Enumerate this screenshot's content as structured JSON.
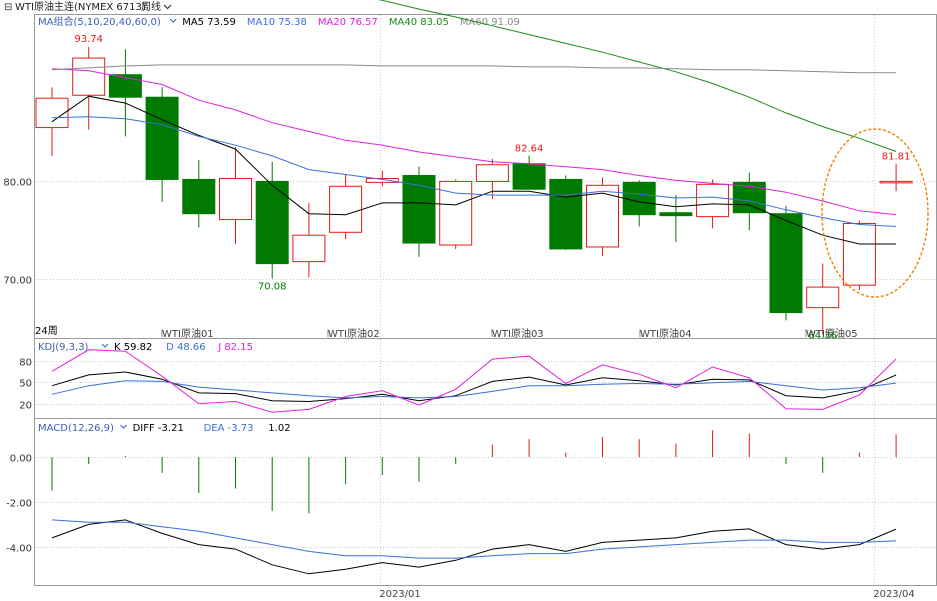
{
  "header": {
    "instrument": "WTI原油主连(NYMEX 6713)",
    "period": "周线",
    "dropdown_arrow": "chevron-down-icon"
  },
  "colors": {
    "up": "#e31a1a",
    "down": "#007a00",
    "ma5": "#000000",
    "ma10": "#3b6fd6",
    "ma20": "#e020e0",
    "ma40": "#1a8a1a",
    "ma60": "#8a8a8a",
    "k": "#000000",
    "d": "#3b6fd6",
    "j": "#e020e0",
    "highlight_ellipse": "#f08000"
  },
  "ma_legend": {
    "label": "MA组合(5,10,20,40,60,0)",
    "items": [
      {
        "name": "MA5",
        "value": "73.59"
      },
      {
        "name": "MA10",
        "value": "75.38"
      },
      {
        "name": "MA20",
        "value": "76.57"
      },
      {
        "name": "MA40",
        "value": "83.05"
      },
      {
        "name": "MA60",
        "value": "91.09"
      }
    ]
  },
  "kdj_legend": {
    "label": "KDJ(9,3,3)",
    "items": [
      {
        "name": "K",
        "value": "59.82"
      },
      {
        "name": "D",
        "value": "48.66"
      },
      {
        "name": "J",
        "value": "82.15"
      }
    ]
  },
  "macd_legend": {
    "label": "MACD(12,26,9)",
    "items": [
      {
        "name": "DIFF",
        "value": "-3.21"
      },
      {
        "name": "DEA",
        "value": "-3.73"
      },
      {
        "name": "",
        "value": "1.02"
      }
    ]
  },
  "price_annotations": {
    "high": "93.74",
    "low": "70.08",
    "recent_high": "82.64",
    "last": "81.81",
    "recent_low": "64.36"
  },
  "period_marker": "24周",
  "contract_labels": [
    "WTI原油01",
    "WTI原油02",
    "WTI原油03",
    "WTI原油04",
    "WTI原油05"
  ],
  "x_date_labels": [
    "2023/01",
    "2023/04"
  ],
  "chart_data": [
    {
      "type": "candlestick",
      "name": "price",
      "ylim": [
        64,
        97
      ],
      "yticks": [
        "80.00",
        "70.00"
      ],
      "ytick_values": [
        80,
        70
      ],
      "candles": [
        {
          "o": 85.5,
          "h": 89.6,
          "l": 82.6,
          "c": 88.5
        },
        {
          "o": 88.8,
          "h": 93.74,
          "l": 85.3,
          "c": 92.6
        },
        {
          "o": 90.9,
          "h": 93.5,
          "l": 84.6,
          "c": 88.6
        },
        {
          "o": 88.6,
          "h": 89.6,
          "l": 77.9,
          "c": 80.2
        },
        {
          "o": 80.2,
          "h": 82.2,
          "l": 75.3,
          "c": 76.7
        },
        {
          "o": 76.1,
          "h": 83.5,
          "l": 73.6,
          "c": 80.3
        },
        {
          "o": 80.0,
          "h": 82.0,
          "l": 70.08,
          "c": 71.6
        },
        {
          "o": 71.8,
          "h": 77.8,
          "l": 70.2,
          "c": 74.5
        },
        {
          "o": 74.8,
          "h": 80.7,
          "l": 74.1,
          "c": 79.5
        },
        {
          "o": 79.9,
          "h": 81.1,
          "l": 79.5,
          "c": 80.3
        },
        {
          "o": 80.6,
          "h": 81.5,
          "l": 72.3,
          "c": 73.7
        },
        {
          "o": 73.5,
          "h": 80.2,
          "l": 73.1,
          "c": 80.0
        },
        {
          "o": 80.0,
          "h": 82.3,
          "l": 78.2,
          "c": 81.7
        },
        {
          "o": 81.8,
          "h": 82.64,
          "l": 79.2,
          "c": 79.2
        },
        {
          "o": 80.2,
          "h": 80.6,
          "l": 73.0,
          "c": 73.1
        },
        {
          "o": 73.3,
          "h": 80.4,
          "l": 72.4,
          "c": 79.6
        },
        {
          "o": 79.9,
          "h": 80.1,
          "l": 75.4,
          "c": 76.6
        },
        {
          "o": 76.8,
          "h": 78.6,
          "l": 73.8,
          "c": 76.5
        },
        {
          "o": 76.4,
          "h": 80.2,
          "l": 75.2,
          "c": 79.7
        },
        {
          "o": 79.9,
          "h": 80.9,
          "l": 75.0,
          "c": 76.8
        },
        {
          "o": 76.7,
          "h": 77.5,
          "l": 65.8,
          "c": 66.6
        },
        {
          "o": 67.1,
          "h": 71.6,
          "l": 64.36,
          "c": 69.2
        },
        {
          "o": 69.4,
          "h": 76.0,
          "l": 68.9,
          "c": 75.7
        },
        {
          "o": 80.0,
          "h": 81.81,
          "l": 79.0,
          "c": 80.0
        }
      ],
      "series": [
        {
          "name": "MA5",
          "values": [
            86.1,
            88.7,
            88.0,
            86.3,
            84.7,
            83.3,
            79.6,
            76.7,
            76.6,
            77.8,
            77.8,
            77.6,
            79.0,
            79.0,
            78.4,
            78.8,
            77.9,
            77.4,
            77.7,
            77.6,
            76.0,
            74.5,
            73.6,
            73.6
          ]
        },
        {
          "name": "MA10",
          "values": [
            86.5,
            86.6,
            86.4,
            85.8,
            84.6,
            83.7,
            82.6,
            81.2,
            80.7,
            80.2,
            79.6,
            78.8,
            78.6,
            78.6,
            78.6,
            79.0,
            78.7,
            78.3,
            78.4,
            78.0,
            77.1,
            76.3,
            75.6,
            75.4
          ]
        },
        {
          "name": "MA20",
          "values": [
            91.5,
            91.3,
            90.6,
            89.9,
            88.3,
            87.3,
            86.0,
            85.1,
            84.2,
            83.7,
            83.0,
            82.5,
            82.0,
            81.8,
            81.5,
            81.2,
            80.6,
            80.1,
            79.8,
            79.5,
            78.9,
            78.0,
            77.0,
            76.6
          ]
        },
        {
          "name": "MA40",
          "values": [
            null,
            null,
            null,
            null,
            null,
            null,
            null,
            null,
            99.2,
            98.5,
            97.6,
            96.8,
            95.9,
            95.0,
            94.1,
            93.2,
            92.2,
            91.2,
            90.0,
            88.6,
            87.0,
            85.6,
            84.4,
            83.05
          ]
        },
        {
          "name": "MA60",
          "values": [
            91.4,
            91.6,
            91.8,
            91.9,
            91.9,
            91.9,
            91.9,
            91.9,
            91.9,
            91.8,
            91.8,
            91.8,
            91.8,
            91.7,
            91.7,
            91.6,
            91.6,
            91.5,
            91.4,
            91.4,
            91.3,
            91.2,
            91.1,
            91.09
          ]
        }
      ]
    },
    {
      "type": "line",
      "name": "KDJ",
      "ylim": [
        0,
        110
      ],
      "yticks": [
        "80",
        "50",
        "20"
      ],
      "ytick_values": [
        80,
        50,
        20
      ],
      "series": [
        {
          "name": "K",
          "values": [
            45,
            60,
            64,
            54,
            35,
            34,
            24,
            23,
            27,
            33,
            24,
            31,
            51,
            57,
            46,
            56,
            52,
            46,
            54,
            53,
            31,
            28,
            38,
            59.82
          ]
        },
        {
          "name": "D",
          "values": [
            33,
            45,
            52,
            51,
            43,
            39,
            35,
            31,
            28,
            30,
            28,
            30,
            37,
            45,
            45,
            47,
            48,
            47,
            49,
            51,
            45,
            39,
            42,
            48.66
          ]
        },
        {
          "name": "J",
          "values": [
            65,
            95,
            93,
            58,
            20,
            23,
            8,
            12,
            30,
            38,
            18,
            40,
            82,
            86,
            48,
            74,
            61,
            42,
            71,
            56,
            13,
            12,
            32,
            82.15
          ]
        }
      ]
    },
    {
      "type": "bar+line",
      "name": "MACD",
      "ylim": [
        -5.7,
        1.7
      ],
      "yticks": [
        "0.00",
        "-2.00",
        "-4.00"
      ],
      "ytick_values": [
        0,
        -2,
        -4
      ],
      "bars": [
        -1.5,
        -0.3,
        0.05,
        -0.7,
        -1.6,
        -1.4,
        -2.4,
        -2.5,
        -1.2,
        -0.8,
        -1.1,
        -0.3,
        0.55,
        0.8,
        0.2,
        0.9,
        0.8,
        0.6,
        1.2,
        1.05,
        -0.3,
        -0.7,
        0.2,
        1.02
      ],
      "series": [
        {
          "name": "DIFF",
          "values": [
            -3.6,
            -3.0,
            -2.8,
            -3.4,
            -3.9,
            -4.1,
            -4.8,
            -5.2,
            -5.0,
            -4.7,
            -4.9,
            -4.6,
            -4.1,
            -3.9,
            -4.2,
            -3.8,
            -3.7,
            -3.6,
            -3.3,
            -3.2,
            -3.9,
            -4.1,
            -3.9,
            -3.21
          ]
        },
        {
          "name": "DEA",
          "values": [
            -2.8,
            -2.9,
            -2.9,
            -3.1,
            -3.3,
            -3.6,
            -3.9,
            -4.2,
            -4.4,
            -4.4,
            -4.5,
            -4.5,
            -4.4,
            -4.3,
            -4.3,
            -4.1,
            -4.0,
            -3.9,
            -3.8,
            -3.7,
            -3.7,
            -3.8,
            -3.8,
            -3.73
          ]
        }
      ]
    }
  ]
}
